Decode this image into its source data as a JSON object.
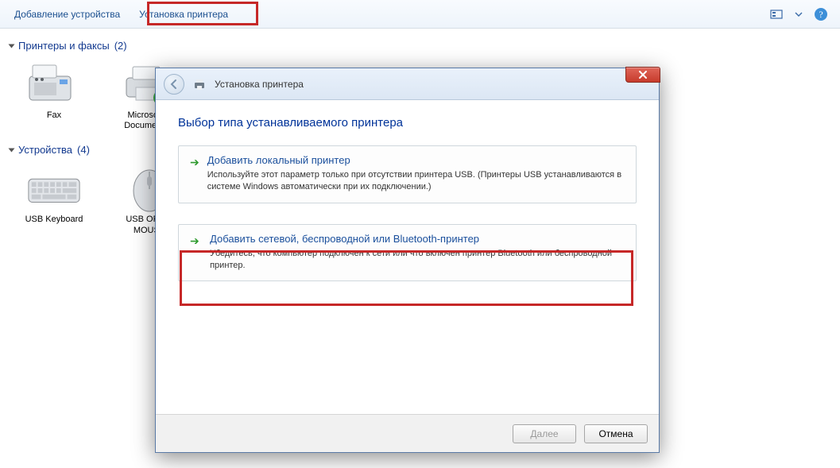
{
  "toolbar": {
    "add_device": "Добавление устройства",
    "install_printer": "Установка принтера"
  },
  "sections": {
    "printers": {
      "title": "Принтеры и факсы",
      "count": "(2)"
    },
    "devices": {
      "title": "Устройства",
      "count": "(4)"
    }
  },
  "printers": [
    {
      "label": "Fax"
    },
    {
      "label": "Microsoft X Document W"
    }
  ],
  "devices": [
    {
      "label": "USB Keyboard"
    },
    {
      "label": "USB OPTIC MOUSE"
    }
  ],
  "wizard": {
    "title": "Установка принтера",
    "heading": "Выбор типа устанавливаемого принтера",
    "options": {
      "local": {
        "title": "Добавить локальный принтер",
        "desc": "Используйте этот параметр только при отсутствии принтера USB. (Принтеры USB устанавливаются в системе Windows автоматически при их подключении.)"
      },
      "network": {
        "title": "Добавить сетевой, беспроводной или Bluetooth-принтер",
        "desc": "Убедитесь, что компьютер подключен к сети или что включен принтер Bluetooth или беспроводной принтер."
      }
    },
    "buttons": {
      "next": "Далее",
      "cancel": "Отмена"
    }
  }
}
